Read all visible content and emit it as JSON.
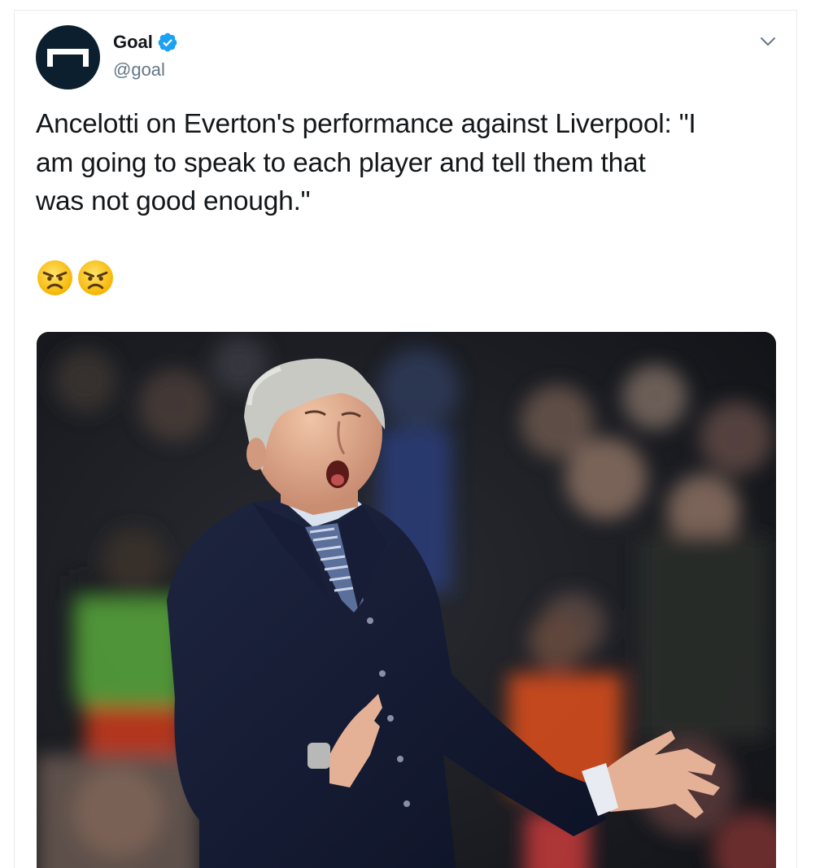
{
  "tweet": {
    "author": {
      "display_name": "Goal",
      "handle": "@goal",
      "verified": true
    },
    "text_lines": [
      "Ancelotti on Everton's performance against Liverpool: \"I",
      "am going to speak to each player and tell them that",
      "was not good enough.\""
    ],
    "emojis": [
      "angry-face",
      "angry-face"
    ],
    "media": {
      "kind": "photo"
    }
  },
  "colors": {
    "text": "#14171a",
    "secondary": "#657786",
    "verified": "#1da1f2",
    "avatar_bg": "#0b1f2e",
    "border": "#e6ecf0"
  },
  "icons": {
    "verified": "verified-badge-icon",
    "menu": "chevron-down-icon",
    "emoji": "angry-face-emoji"
  }
}
